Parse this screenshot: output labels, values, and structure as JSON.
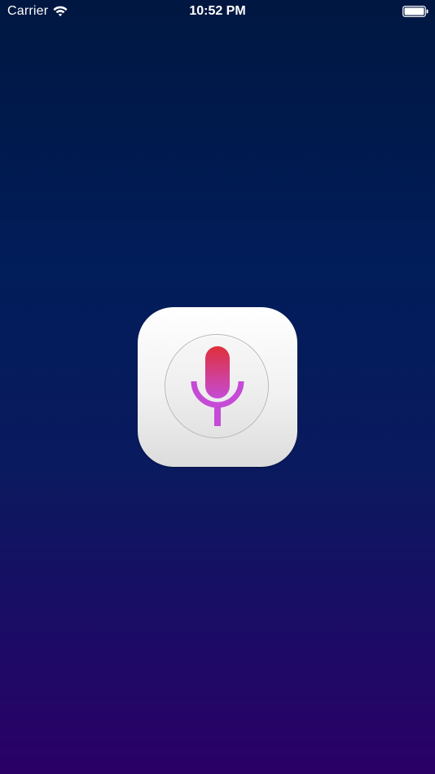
{
  "status_bar": {
    "carrier": "Carrier",
    "time": "10:52 PM",
    "wifi_icon": "wifi-icon",
    "battery_icon": "battery-icon"
  },
  "app_icon": {
    "icon": "microphone-icon",
    "colors": {
      "mic_top": "#e0303a",
      "mic_bottom": "#c54bd6",
      "stand": "#c54bd6"
    }
  },
  "colors": {
    "background_top": "#001741",
    "background_bottom": "#2a0066"
  }
}
